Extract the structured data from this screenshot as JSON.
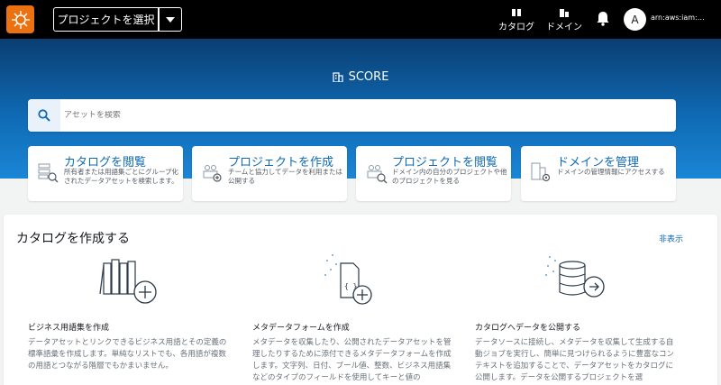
{
  "topnav": {
    "project_select_label": "プロジェクトを選択",
    "catalog_label": "カタログ",
    "domain_label": "ドメイン",
    "avatar_initial": "A",
    "user_arn": "arn:aws:iam:…"
  },
  "hero": {
    "title": "SCORE"
  },
  "search": {
    "placeholder": "アセットを検索"
  },
  "quick_cards": [
    {
      "title": "カタログを閲覧",
      "desc": "所有者または用語集ごとにグループ化されたデータアセットを検索します。"
    },
    {
      "title": "プロジェクトを作成",
      "desc": "チームと協力してデータを利用または公開する"
    },
    {
      "title": "プロジェクトを閲覧",
      "desc": "ドメイン内の自分のプロジェクトや他のプロジェクトを見る"
    },
    {
      "title": "ドメインを管理",
      "desc": "ドメインの管理情報にアクセスする"
    }
  ],
  "create_catalog": {
    "title": "カタログを作成する",
    "hide_label": "非表示",
    "features": [
      {
        "title": "ビジネス用語集を作成",
        "desc": "データアセットとリンクできるビジネス用語とその定義の標準語彙を作成します。単純なリストでも、各用語が複数の用語とつながる階層でもかまいません。"
      },
      {
        "title": "メタデータフォームを作成",
        "desc": "メタデータを収集したり、公開されたデータアセットを管理したりするために添付できるメタデータフォームを作成します。文字列、日付、ブール値、整数、ビジネス用語集などのタイプのフィールドを使用してキーと値の"
      },
      {
        "title": "カタログへデータを公開する",
        "desc": "データソースに接続し、メタデータを収集して生成する自動ジョブを実行し、簡単に見つけられるように豊富なコンテキストを追加することで、データアセットをカタログに公開します。データを公開するプロジェクトを選"
      }
    ]
  },
  "colors": {
    "accent": "#0f6ab4",
    "logo": "#ec7211",
    "nav_bg": "#000000"
  }
}
